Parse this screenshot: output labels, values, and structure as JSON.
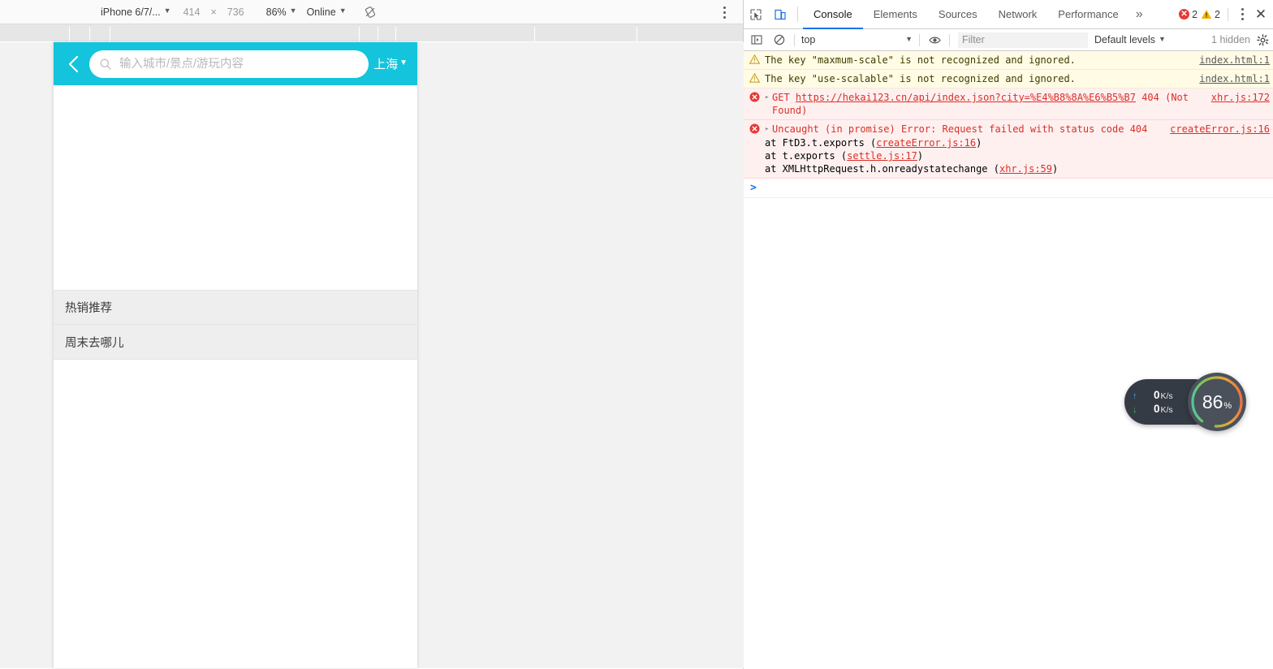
{
  "device_toolbar": {
    "device_name": "iPhone 6/7/...",
    "device_caret": "▼",
    "width": "414",
    "times": "×",
    "height": "736",
    "zoom": "86%",
    "zoom_caret": "▼",
    "network": "Online",
    "network_caret": "▼",
    "throttle_icon": "rotate-icon",
    "menu_icon": "kebab-menu-icon"
  },
  "phone_app": {
    "back_icon": "back-chevron-icon",
    "search_icon": "search-icon",
    "search_placeholder": "输入城市/景点/游玩内容",
    "search_value": "",
    "city": "上海",
    "city_caret": "▼",
    "header_color": "#14c4dc",
    "list_items": [
      {
        "label": "热销推荐"
      },
      {
        "label": "周末去哪儿"
      }
    ]
  },
  "devtools": {
    "inspect_icon": "inspect-cursor-icon",
    "device_toggle_icon": "device-toolbar-icon",
    "tabs": [
      {
        "label": "Console",
        "active": true
      },
      {
        "label": "Elements",
        "active": false
      },
      {
        "label": "Sources",
        "active": false
      },
      {
        "label": "Network",
        "active": false
      },
      {
        "label": "Performance",
        "active": false
      }
    ],
    "more_tabs_icon": "»",
    "error_count": "2",
    "warning_count": "2",
    "settings_kebab_icon": "kebab-menu-icon",
    "close_icon": "✕",
    "console_toolbar": {
      "sidebar_icon": "console-sidebar-icon",
      "clear_icon": "clear-console-icon",
      "context": "top",
      "context_caret": "▼",
      "eye_icon": "live-expression-icon",
      "filter_placeholder": "Filter",
      "filter_value": "",
      "levels": "Default levels",
      "levels_caret": "▼",
      "hidden_count": "1 hidden",
      "gear_icon": "settings-gear-icon"
    },
    "messages": [
      {
        "type": "warning",
        "icon": "warning-triangle-icon",
        "text": "The key \"maxmum-scale\" is not recognized and ignored.",
        "source": "index.html:1"
      },
      {
        "type": "warning",
        "icon": "warning-triangle-icon",
        "text": "The key \"use-scalable\" is not recognized and ignored.",
        "source": "index.html:1"
      },
      {
        "type": "error",
        "icon": "error-circle-icon",
        "expand_arrow": "▸",
        "method": "GET",
        "url": "https://hekai123.cn/api/index.json?city=%E4%B8%8A%E6%B5%B7",
        "status": "404",
        "status_text": "(Not Found)",
        "source": "xhr.js:172"
      },
      {
        "type": "error",
        "icon": "error-circle-icon",
        "expand_arrow": "▸",
        "text": "Uncaught (in promise) Error: Request failed with status code 404",
        "source": "createError.js:16",
        "stack": [
          {
            "prefix": "    at FtD3.t.exports (",
            "link": "createError.js:16",
            "suffix": ")"
          },
          {
            "prefix": "    at t.exports (",
            "link": "settle.js:17",
            "suffix": ")"
          },
          {
            "prefix": "    at XMLHttpRequest.h.onreadystatechange (",
            "link": "xhr.js:59",
            "suffix": ")"
          }
        ]
      }
    ],
    "prompt": ">"
  },
  "net_widget": {
    "upload_arrow": "↑",
    "upload_value": "0",
    "upload_unit": "K/s",
    "download_arrow": "↓",
    "download_value": "0",
    "download_unit": "K/s",
    "gauge_value": "86",
    "gauge_unit": "%",
    "upload_color": "#3fa9f5",
    "download_color": "#39c05a"
  }
}
